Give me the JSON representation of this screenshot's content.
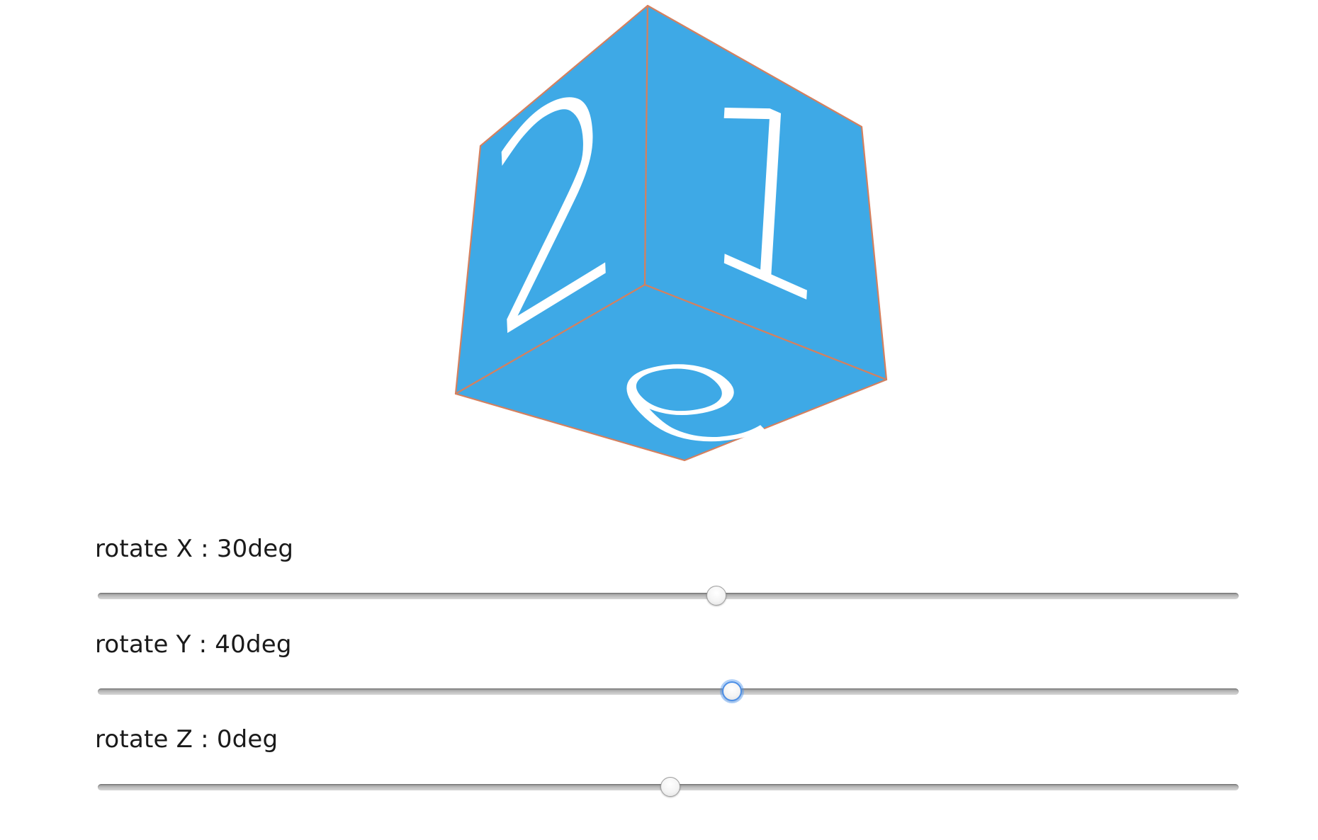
{
  "cube": {
    "face_color": "#3ea9e6",
    "edge_color": "#d4805f",
    "digit_color": "#ffffff",
    "faces": {
      "left": "2",
      "right": "1",
      "bottom": "6"
    }
  },
  "controls": {
    "rotate_x": {
      "label": "rotate X : 30deg",
      "value_fraction": 0.542
    },
    "rotate_y": {
      "label": "rotate Y : 40deg",
      "value_fraction": 0.556,
      "focused": true
    },
    "rotate_z": {
      "label": "rotate Z : 0deg",
      "value_fraction": 0.502
    }
  }
}
